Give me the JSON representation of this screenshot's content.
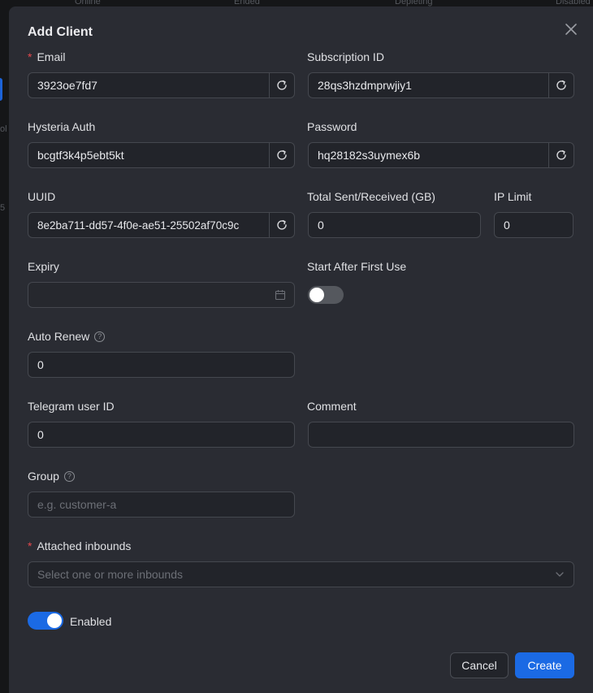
{
  "background": {
    "header_cols": [
      "Online",
      "Ended",
      "Depleting",
      "Disabled"
    ],
    "left_fragments": [
      "ol",
      "5"
    ]
  },
  "modal": {
    "title": "Add Client",
    "fields": {
      "email": {
        "label": "Email",
        "required": true,
        "value": "3923oe7fd7"
      },
      "subscription_id": {
        "label": "Subscription ID",
        "value": "28qs3hzdmprwjiy1"
      },
      "hysteria_auth": {
        "label": "Hysteria Auth",
        "value": "bcgtf3k4p5ebt5kt"
      },
      "password": {
        "label": "Password",
        "value": "hq28182s3uymex6b"
      },
      "uuid": {
        "label": "UUID",
        "value": "8e2ba711-dd57-4f0e-ae51-25502af70c9c"
      },
      "total": {
        "label": "Total Sent/Received (GB)",
        "value": "0"
      },
      "ip_limit": {
        "label": "IP Limit",
        "value": "0"
      },
      "expiry": {
        "label": "Expiry",
        "value": ""
      },
      "start_after_first_use": {
        "label": "Start After First Use",
        "on": false
      },
      "auto_renew": {
        "label": "Auto Renew",
        "value": "0"
      },
      "telegram": {
        "label": "Telegram user ID",
        "value": "0"
      },
      "comment": {
        "label": "Comment",
        "value": ""
      },
      "group": {
        "label": "Group",
        "placeholder": "e.g. customer-a"
      },
      "attached_inbounds": {
        "label": "Attached inbounds",
        "required": true,
        "placeholder": "Select one or more inbounds"
      },
      "enabled": {
        "label": "Enabled",
        "on": true
      }
    },
    "buttons": {
      "cancel": "Cancel",
      "create": "Create"
    }
  },
  "icons": {
    "refresh": "refresh-icon",
    "calendar": "calendar-icon",
    "chevron": "chevron-down-icon",
    "close": "close-icon",
    "help": "question-circle-icon"
  },
  "colors": {
    "primary": "#1b6ae4",
    "toggle_off": "#55585e",
    "required": "#e5484d",
    "modal_bg": "#2a2c33",
    "input_bg": "#22242a"
  }
}
